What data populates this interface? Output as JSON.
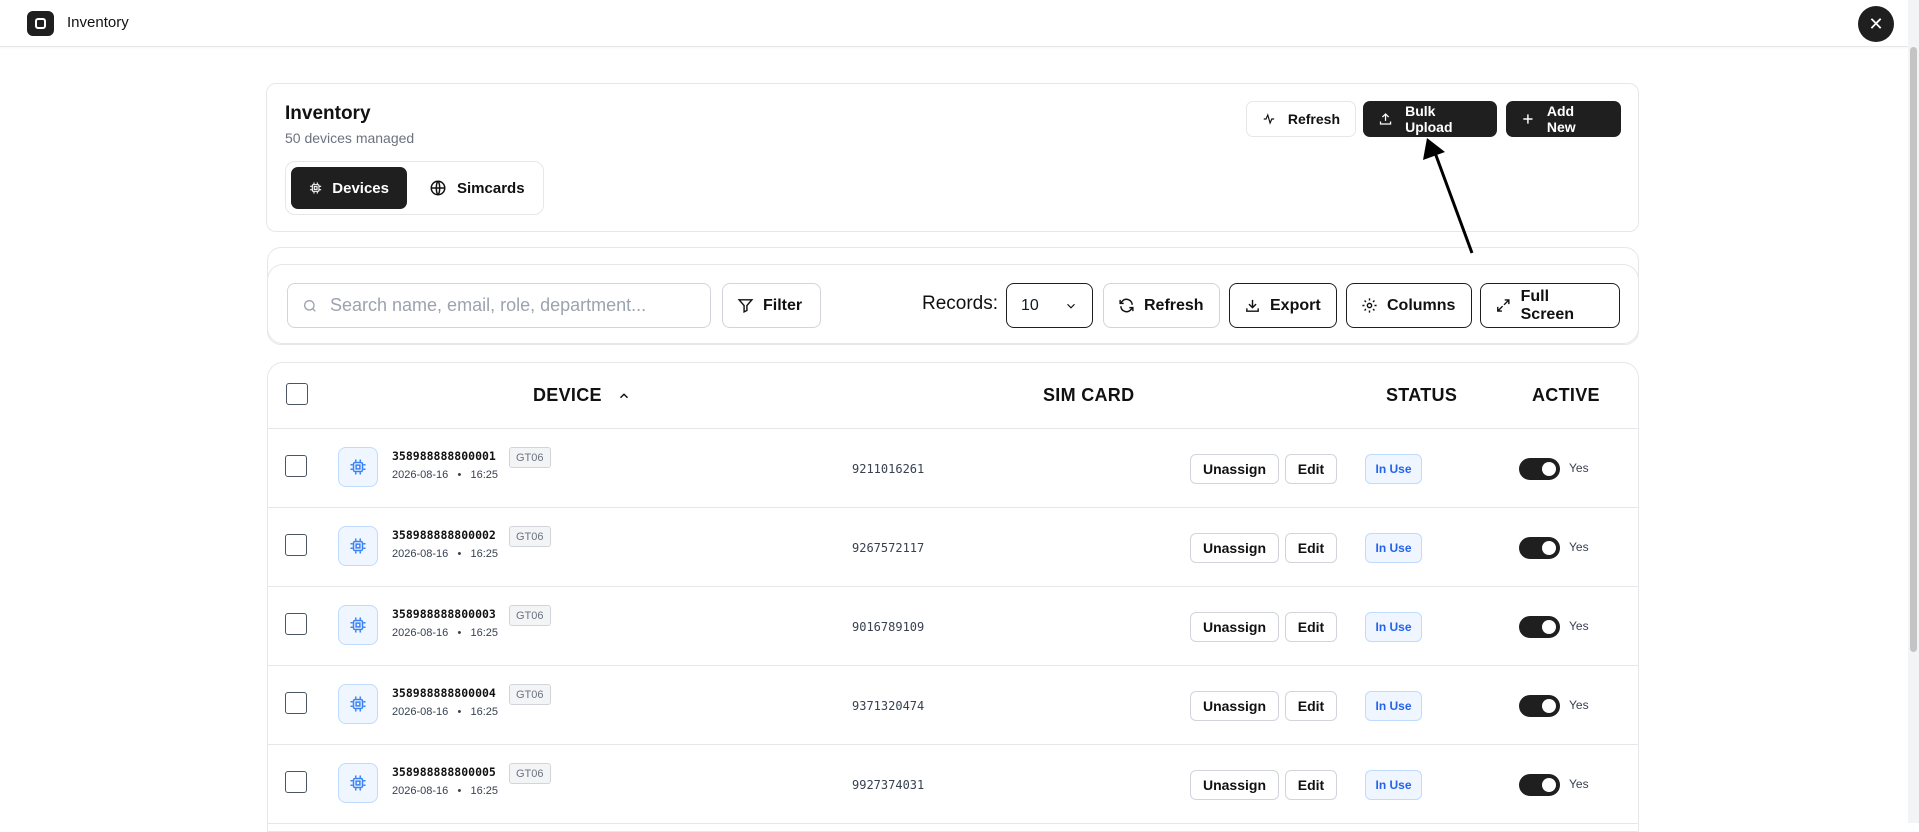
{
  "app": {
    "title": "Inventory",
    "close_symbol": "✕"
  },
  "header": {
    "title": "Inventory",
    "subtitle": "50 devices managed",
    "tabs": [
      {
        "label": "Devices",
        "icon": "chip-icon",
        "active": true
      },
      {
        "label": "Simcards",
        "icon": "globe-icon",
        "active": false
      }
    ],
    "buttons": {
      "refresh": "Refresh",
      "bulk_upload": "Bulk Upload",
      "add_new": "Add New"
    }
  },
  "toolbar": {
    "search_placeholder": "Search name, email, role, department...",
    "filter": "Filter",
    "records_label": "Records:",
    "records_value": "10",
    "refresh": "Refresh",
    "export": "Export",
    "columns": "Columns",
    "full_screen": "Full Screen"
  },
  "table": {
    "columns": {
      "device": "DEVICE",
      "sim": "SIM CARD",
      "status": "STATUS",
      "active": "ACTIVE"
    },
    "rows": [
      {
        "imei": "358988888800001",
        "model": "GT06",
        "date": "2026-08-16",
        "time": "16:25",
        "sim": "9211016261",
        "unassign": "Unassign",
        "edit": "Edit",
        "status": "In Use",
        "active": "Yes"
      },
      {
        "imei": "358988888800002",
        "model": "GT06",
        "date": "2026-08-16",
        "time": "16:25",
        "sim": "9267572117",
        "unassign": "Unassign",
        "edit": "Edit",
        "status": "In Use",
        "active": "Yes"
      },
      {
        "imei": "358988888800003",
        "model": "GT06",
        "date": "2026-08-16",
        "time": "16:25",
        "sim": "9016789109",
        "unassign": "Unassign",
        "edit": "Edit",
        "status": "In Use",
        "active": "Yes"
      },
      {
        "imei": "358988888800004",
        "model": "GT06",
        "date": "2026-08-16",
        "time": "16:25",
        "sim": "9371320474",
        "unassign": "Unassign",
        "edit": "Edit",
        "status": "In Use",
        "active": "Yes"
      },
      {
        "imei": "358988888800005",
        "model": "GT06",
        "date": "2026-08-16",
        "time": "16:25",
        "sim": "9927374031",
        "unassign": "Unassign",
        "edit": "Edit",
        "status": "In Use",
        "active": "Yes"
      }
    ]
  },
  "colors": {
    "primary": "#1f1f1f",
    "accent_blue": "#2563eb",
    "border": "#e5e7eb"
  }
}
